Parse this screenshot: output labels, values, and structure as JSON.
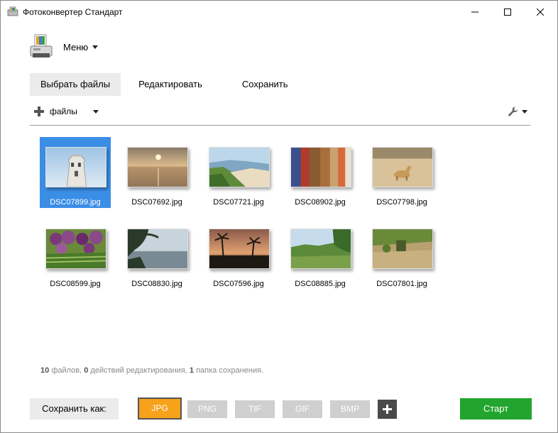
{
  "window": {
    "title": "Фотоконвертер Стандарт"
  },
  "menu": {
    "label": "Меню"
  },
  "tabs": [
    {
      "label": "Выбрать файлы",
      "active": true
    },
    {
      "label": "Редактировать",
      "active": false
    },
    {
      "label": "Сохранить",
      "active": false
    }
  ],
  "toolbar": {
    "add_files_label": "файлы"
  },
  "files": [
    {
      "name": "DSC07899.jpg",
      "selected": true
    },
    {
      "name": "DSC07692.jpg",
      "selected": false
    },
    {
      "name": "DSC07721.jpg",
      "selected": false
    },
    {
      "name": "DSC08902.jpg",
      "selected": false
    },
    {
      "name": "DSC07798.jpg",
      "selected": false
    },
    {
      "name": "DSC08599.jpg",
      "selected": false
    },
    {
      "name": "DSC08830.jpg",
      "selected": false
    },
    {
      "name": "DSC07596.jpg",
      "selected": false
    },
    {
      "name": "DSC08885.jpg",
      "selected": false
    },
    {
      "name": "DSC07801.jpg",
      "selected": false
    }
  ],
  "status": {
    "files_count": "10",
    "files_text": "файлов,",
    "edits_count": "0",
    "edits_text": "действий редактирования,",
    "folders_count": "1",
    "folders_text": "папка сохранения."
  },
  "bottom": {
    "save_as_label": "Сохранить как:",
    "formats": [
      {
        "label": "JPG",
        "active": true
      },
      {
        "label": "PNG",
        "active": false
      },
      {
        "label": "TIF",
        "active": false
      },
      {
        "label": "GIF",
        "active": false
      },
      {
        "label": "BMP",
        "active": false
      }
    ],
    "start_label": "Старт"
  },
  "colors": {
    "selection": "#3b8ee6",
    "active_format": "#f7a21b",
    "start": "#22a52e"
  }
}
